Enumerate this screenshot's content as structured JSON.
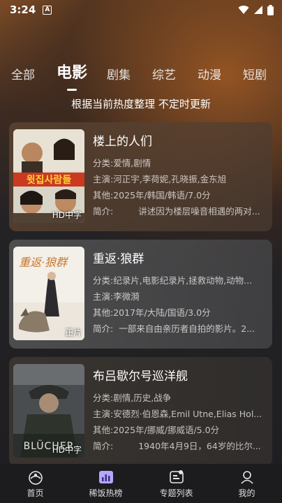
{
  "status_bar": {
    "time": "3:24",
    "notification_icon": "A"
  },
  "tabs": [
    {
      "label": "全部",
      "active": false
    },
    {
      "label": "电影",
      "active": true
    },
    {
      "label": "剧集",
      "active": false
    },
    {
      "label": "综艺",
      "active": false
    },
    {
      "label": "动漫",
      "active": false
    },
    {
      "label": "短剧",
      "active": false
    }
  ],
  "subtitle": "根据当前热度整理 不定时更新",
  "labels": {
    "genre": "分类:",
    "cast": "主演:",
    "other": "其他:",
    "intro": "简介:"
  },
  "movies": [
    {
      "title": "楼上的人们",
      "genre": "爱情,剧情",
      "cast": "河正宇,李荷妮,孔晓振,金东旭",
      "other": "2025年/韩国/韩语/7.0分",
      "intro": "讲述因为楼层噪音相遇的两对...",
      "tag": "HD中字"
    },
    {
      "title": "重返·狼群",
      "genre": "纪录片,电影纪录片,拯救动物,动物...",
      "cast": "李微漪",
      "other": "2017年/大陆/国语/3.0分",
      "intro": "一部来自由亲历者自拍的影片。2...",
      "tag": "正片"
    },
    {
      "title": "布吕歇尔号巡洋舰",
      "genre": "剧情,历史,战争",
      "cast": "安德烈·伯恩森,Emil Utne,Elias Hol...",
      "other": "2025年/挪威/挪威语/5.0分",
      "intro": "1940年4月9日，64岁的比尔...",
      "tag": "HD中字"
    }
  ],
  "bottom_nav": [
    {
      "label": "首页",
      "icon": "home-icon"
    },
    {
      "label": "稀饭热榜",
      "icon": "chart-icon"
    },
    {
      "label": "专题列表",
      "icon": "topic-icon"
    },
    {
      "label": "我的",
      "icon": "profile-icon"
    }
  ]
}
